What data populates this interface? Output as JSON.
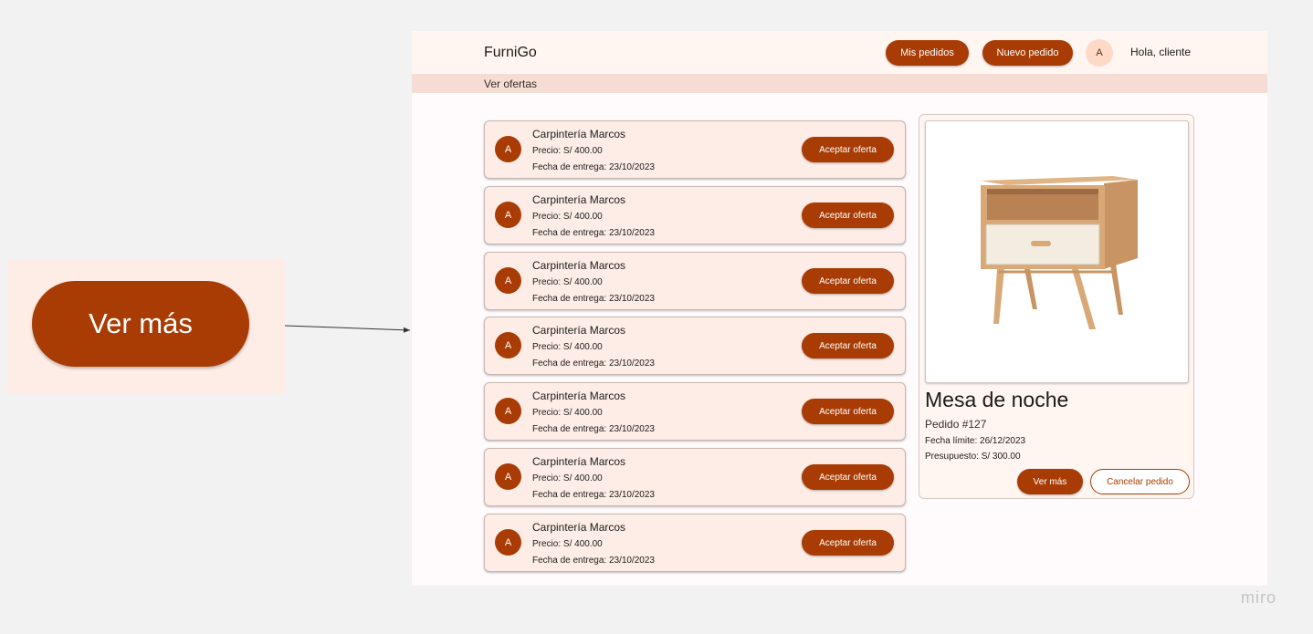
{
  "callout": {
    "button_label": "Ver más"
  },
  "header": {
    "brand": "FurniGo",
    "my_orders": "Mis pedidos",
    "new_order": "Nuevo pedido",
    "avatar_letter": "A",
    "greeting": "Hola, cliente"
  },
  "subheader": {
    "title": "Ver ofertas"
  },
  "offers": [
    {
      "avatar": "A",
      "name": "Carpintería Marcos",
      "price": "Precio: S/ 400.00",
      "date": "Fecha de entrega: 23/10/2023",
      "action": "Aceptar oferta"
    },
    {
      "avatar": "A",
      "name": "Carpintería Marcos",
      "price": "Precio: S/ 400.00",
      "date": "Fecha de entrega: 23/10/2023",
      "action": "Aceptar oferta"
    },
    {
      "avatar": "A",
      "name": "Carpintería Marcos",
      "price": "Precio: S/ 400.00",
      "date": "Fecha de entrega: 23/10/2023",
      "action": "Aceptar oferta"
    },
    {
      "avatar": "A",
      "name": "Carpintería Marcos",
      "price": "Precio: S/ 400.00",
      "date": "Fecha de entrega: 23/10/2023",
      "action": "Aceptar oferta"
    },
    {
      "avatar": "A",
      "name": "Carpintería Marcos",
      "price": "Precio: S/ 400.00",
      "date": "Fecha de entrega: 23/10/2023",
      "action": "Aceptar oferta"
    },
    {
      "avatar": "A",
      "name": "Carpintería Marcos",
      "price": "Precio: S/ 400.00",
      "date": "Fecha de entrega: 23/10/2023",
      "action": "Aceptar oferta"
    },
    {
      "avatar": "A",
      "name": "Carpintería Marcos",
      "price": "Precio: S/ 400.00",
      "date": "Fecha de entrega: 23/10/2023",
      "action": "Aceptar oferta"
    }
  ],
  "product": {
    "image_icon": "nightstand-image",
    "title": "Mesa de noche",
    "order_number": "Pedido #127",
    "deadline": "Fecha límite: 26/12/2023",
    "budget": "Presupuesto: S/ 300.00",
    "more_label": "Ver más",
    "cancel_label": "Cancelar pedido"
  },
  "watermark": "miro",
  "colors": {
    "accent": "#a83c04",
    "card_bg": "#fdede6",
    "subbar_bg": "#f5ddd6",
    "canvas_bg": "#f2f2f2"
  }
}
